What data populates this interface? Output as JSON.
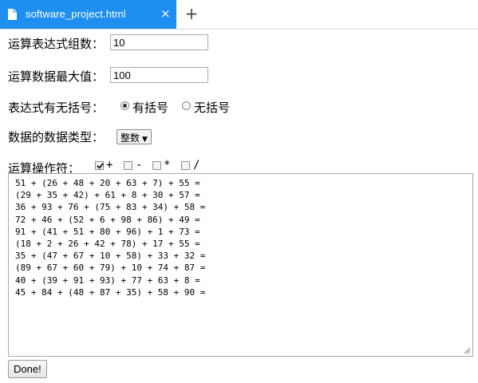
{
  "tab": {
    "title": "software_project.html",
    "close_glyph": "×",
    "new_tab_glyph": "+"
  },
  "form": {
    "count": {
      "label": "运算表达式组数：",
      "value": "10"
    },
    "max": {
      "label": "运算数据最大值：",
      "value": "100"
    },
    "brackets": {
      "label": "表达式有无括号：",
      "options": [
        {
          "label": "有括号",
          "checked": true
        },
        {
          "label": "无括号",
          "checked": false
        }
      ]
    },
    "datatype": {
      "label": "数据的数据类型：",
      "selected": "整数"
    },
    "operators": {
      "label": "运算操作符：",
      "items": [
        {
          "symbol": "+",
          "checked": true
        },
        {
          "symbol": "-",
          "checked": false
        },
        {
          "symbol": "*",
          "checked": false
        },
        {
          "symbol": "/",
          "checked": false
        }
      ]
    }
  },
  "output": {
    "lines": [
      "51 + (26 + 48 + 20 + 63 + 7) + 55 =",
      "(29 + 35 + 42) + 61 + 8 + 30 + 57 =",
      "36 + 93 + 76 + (75 + 83 + 34) + 58 =",
      "72 + 46 + (52 + 6 + 98 + 86) + 49 =",
      "91 + (41 + 51 + 80 + 96) + 1 + 73 =",
      "(18 + 2 + 26 + 42 + 78) + 17 + 55 =",
      "35 + (47 + 67 + 10 + 58) + 33 + 32 =",
      "(89 + 67 + 60 + 79) + 10 + 74 + 87 =",
      "40 + (39 + 91 + 93) + 77 + 63 + 8 =",
      "45 + 84 + (48 + 87 + 35) + 58 + 90 ="
    ]
  },
  "done_button": "Done!",
  "icons": {
    "tab_icon": "file-icon",
    "resize": "resize-grip-icon"
  },
  "colors": {
    "tab_active_bg": "#1e8ff0",
    "tab_text": "#ffffff"
  }
}
